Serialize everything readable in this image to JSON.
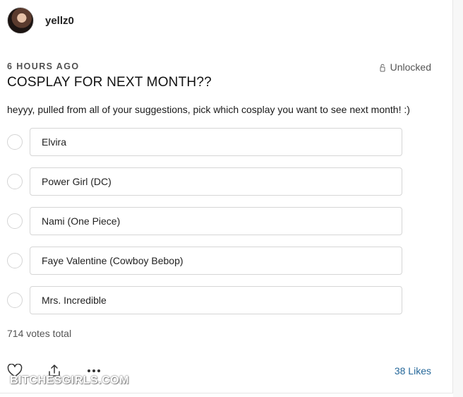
{
  "post": {
    "author": "yellz0",
    "time": "6 HOURS AGO",
    "access": "Unlocked",
    "title": "COSPLAY FOR NEXT MONTH??",
    "description": "heyyy, pulled from all of your suggestions, pick which cosplay you want to see next month! :)"
  },
  "poll": {
    "options": [
      {
        "label": "Elvira"
      },
      {
        "label": "Power Girl (DC)"
      },
      {
        "label": "Nami (One Piece)"
      },
      {
        "label": "Faye Valentine (Cowboy Bebop)"
      },
      {
        "label": "Mrs. Incredible"
      }
    ],
    "votes_total": "714 votes total"
  },
  "footer": {
    "likes": "38 Likes",
    "icons": [
      "heart-icon",
      "share-icon",
      "more-icon"
    ]
  },
  "watermark": "BITCHESGIRLS.COM",
  "colors": {
    "likes": "#26689a",
    "border": "#d6d6d6",
    "text": "#1f1f1f"
  }
}
